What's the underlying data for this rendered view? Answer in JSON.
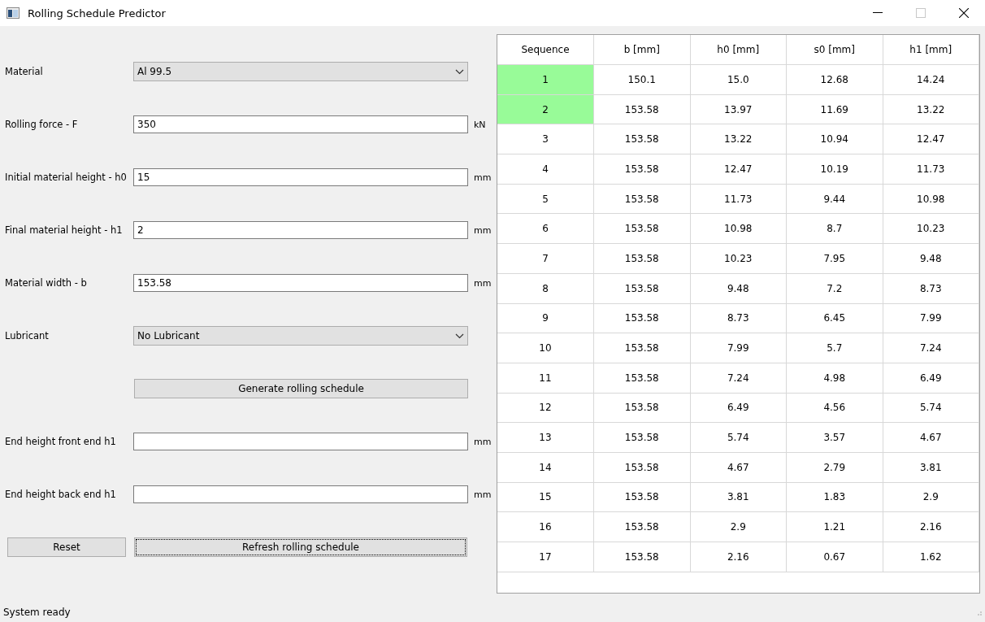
{
  "window": {
    "title": "Rolling Schedule Predictor",
    "maximize_disabled": true
  },
  "form": [
    {
      "kind": "select",
      "label": "Material",
      "value": "Al 99.5"
    },
    {
      "kind": "input",
      "label": "Rolling force - F",
      "value": "350",
      "unit": "kN"
    },
    {
      "kind": "input",
      "label": "Initial material height - h0",
      "value": "15",
      "unit": "mm"
    },
    {
      "kind": "input",
      "label": "Final material height - h1",
      "value": "2",
      "unit": "mm"
    },
    {
      "kind": "input",
      "label": "Material width - b",
      "value": "153.58",
      "unit": "mm"
    },
    {
      "kind": "select",
      "label": "Lubricant",
      "value": "No Lubricant"
    },
    {
      "kind": "button",
      "label": "Generate rolling schedule",
      "focused": false
    },
    {
      "kind": "input",
      "label": "End height front end h1",
      "unit": "mm"
    },
    {
      "kind": "input",
      "label": "End height back end h1",
      "unit": "mm"
    },
    {
      "kind": "buttons",
      "buttons": [
        {
          "label": "Reset",
          "focused": false
        },
        {
          "label": "Refresh rolling schedule",
          "focused": true
        }
      ]
    }
  ],
  "table": {
    "columns": [
      "Sequence",
      "b [mm]",
      "h0 [mm]",
      "s0 [mm]",
      "h1 [mm]"
    ],
    "rows": [
      {
        "cells": [
          "1",
          "150.1",
          "15.0",
          "12.68",
          "14.24"
        ],
        "highlighted": true
      },
      {
        "cells": [
          "2",
          "153.58",
          "13.97",
          "11.69",
          "13.22"
        ],
        "highlighted": true
      },
      {
        "cells": [
          "3",
          "153.58",
          "13.22",
          "10.94",
          "12.47"
        ],
        "highlighted": false
      },
      {
        "cells": [
          "4",
          "153.58",
          "12.47",
          "10.19",
          "11.73"
        ],
        "highlighted": false
      },
      {
        "cells": [
          "5",
          "153.58",
          "11.73",
          "9.44",
          "10.98"
        ],
        "highlighted": false
      },
      {
        "cells": [
          "6",
          "153.58",
          "10.98",
          "8.7",
          "10.23"
        ],
        "highlighted": false
      },
      {
        "cells": [
          "7",
          "153.58",
          "10.23",
          "7.95",
          "9.48"
        ],
        "highlighted": false
      },
      {
        "cells": [
          "8",
          "153.58",
          "9.48",
          "7.2",
          "8.73"
        ],
        "highlighted": false
      },
      {
        "cells": [
          "9",
          "153.58",
          "8.73",
          "6.45",
          "7.99"
        ],
        "highlighted": false
      },
      {
        "cells": [
          "10",
          "153.58",
          "7.99",
          "5.7",
          "7.24"
        ],
        "highlighted": false
      },
      {
        "cells": [
          "11",
          "153.58",
          "7.24",
          "4.98",
          "6.49"
        ],
        "highlighted": false
      },
      {
        "cells": [
          "12",
          "153.58",
          "6.49",
          "4.56",
          "5.74"
        ],
        "highlighted": false
      },
      {
        "cells": [
          "13",
          "153.58",
          "5.74",
          "3.57",
          "4.67"
        ],
        "highlighted": false
      },
      {
        "cells": [
          "14",
          "153.58",
          "4.67",
          "2.79",
          "3.81"
        ],
        "highlighted": false
      },
      {
        "cells": [
          "15",
          "153.58",
          "3.81",
          "1.83",
          "2.9"
        ],
        "highlighted": false
      },
      {
        "cells": [
          "16",
          "153.58",
          "2.9",
          "1.21",
          "2.16"
        ],
        "highlighted": false
      },
      {
        "cells": [
          "17",
          "153.58",
          "2.16",
          "0.67",
          "1.62"
        ],
        "highlighted": false
      }
    ]
  },
  "status_bar": "System ready"
}
